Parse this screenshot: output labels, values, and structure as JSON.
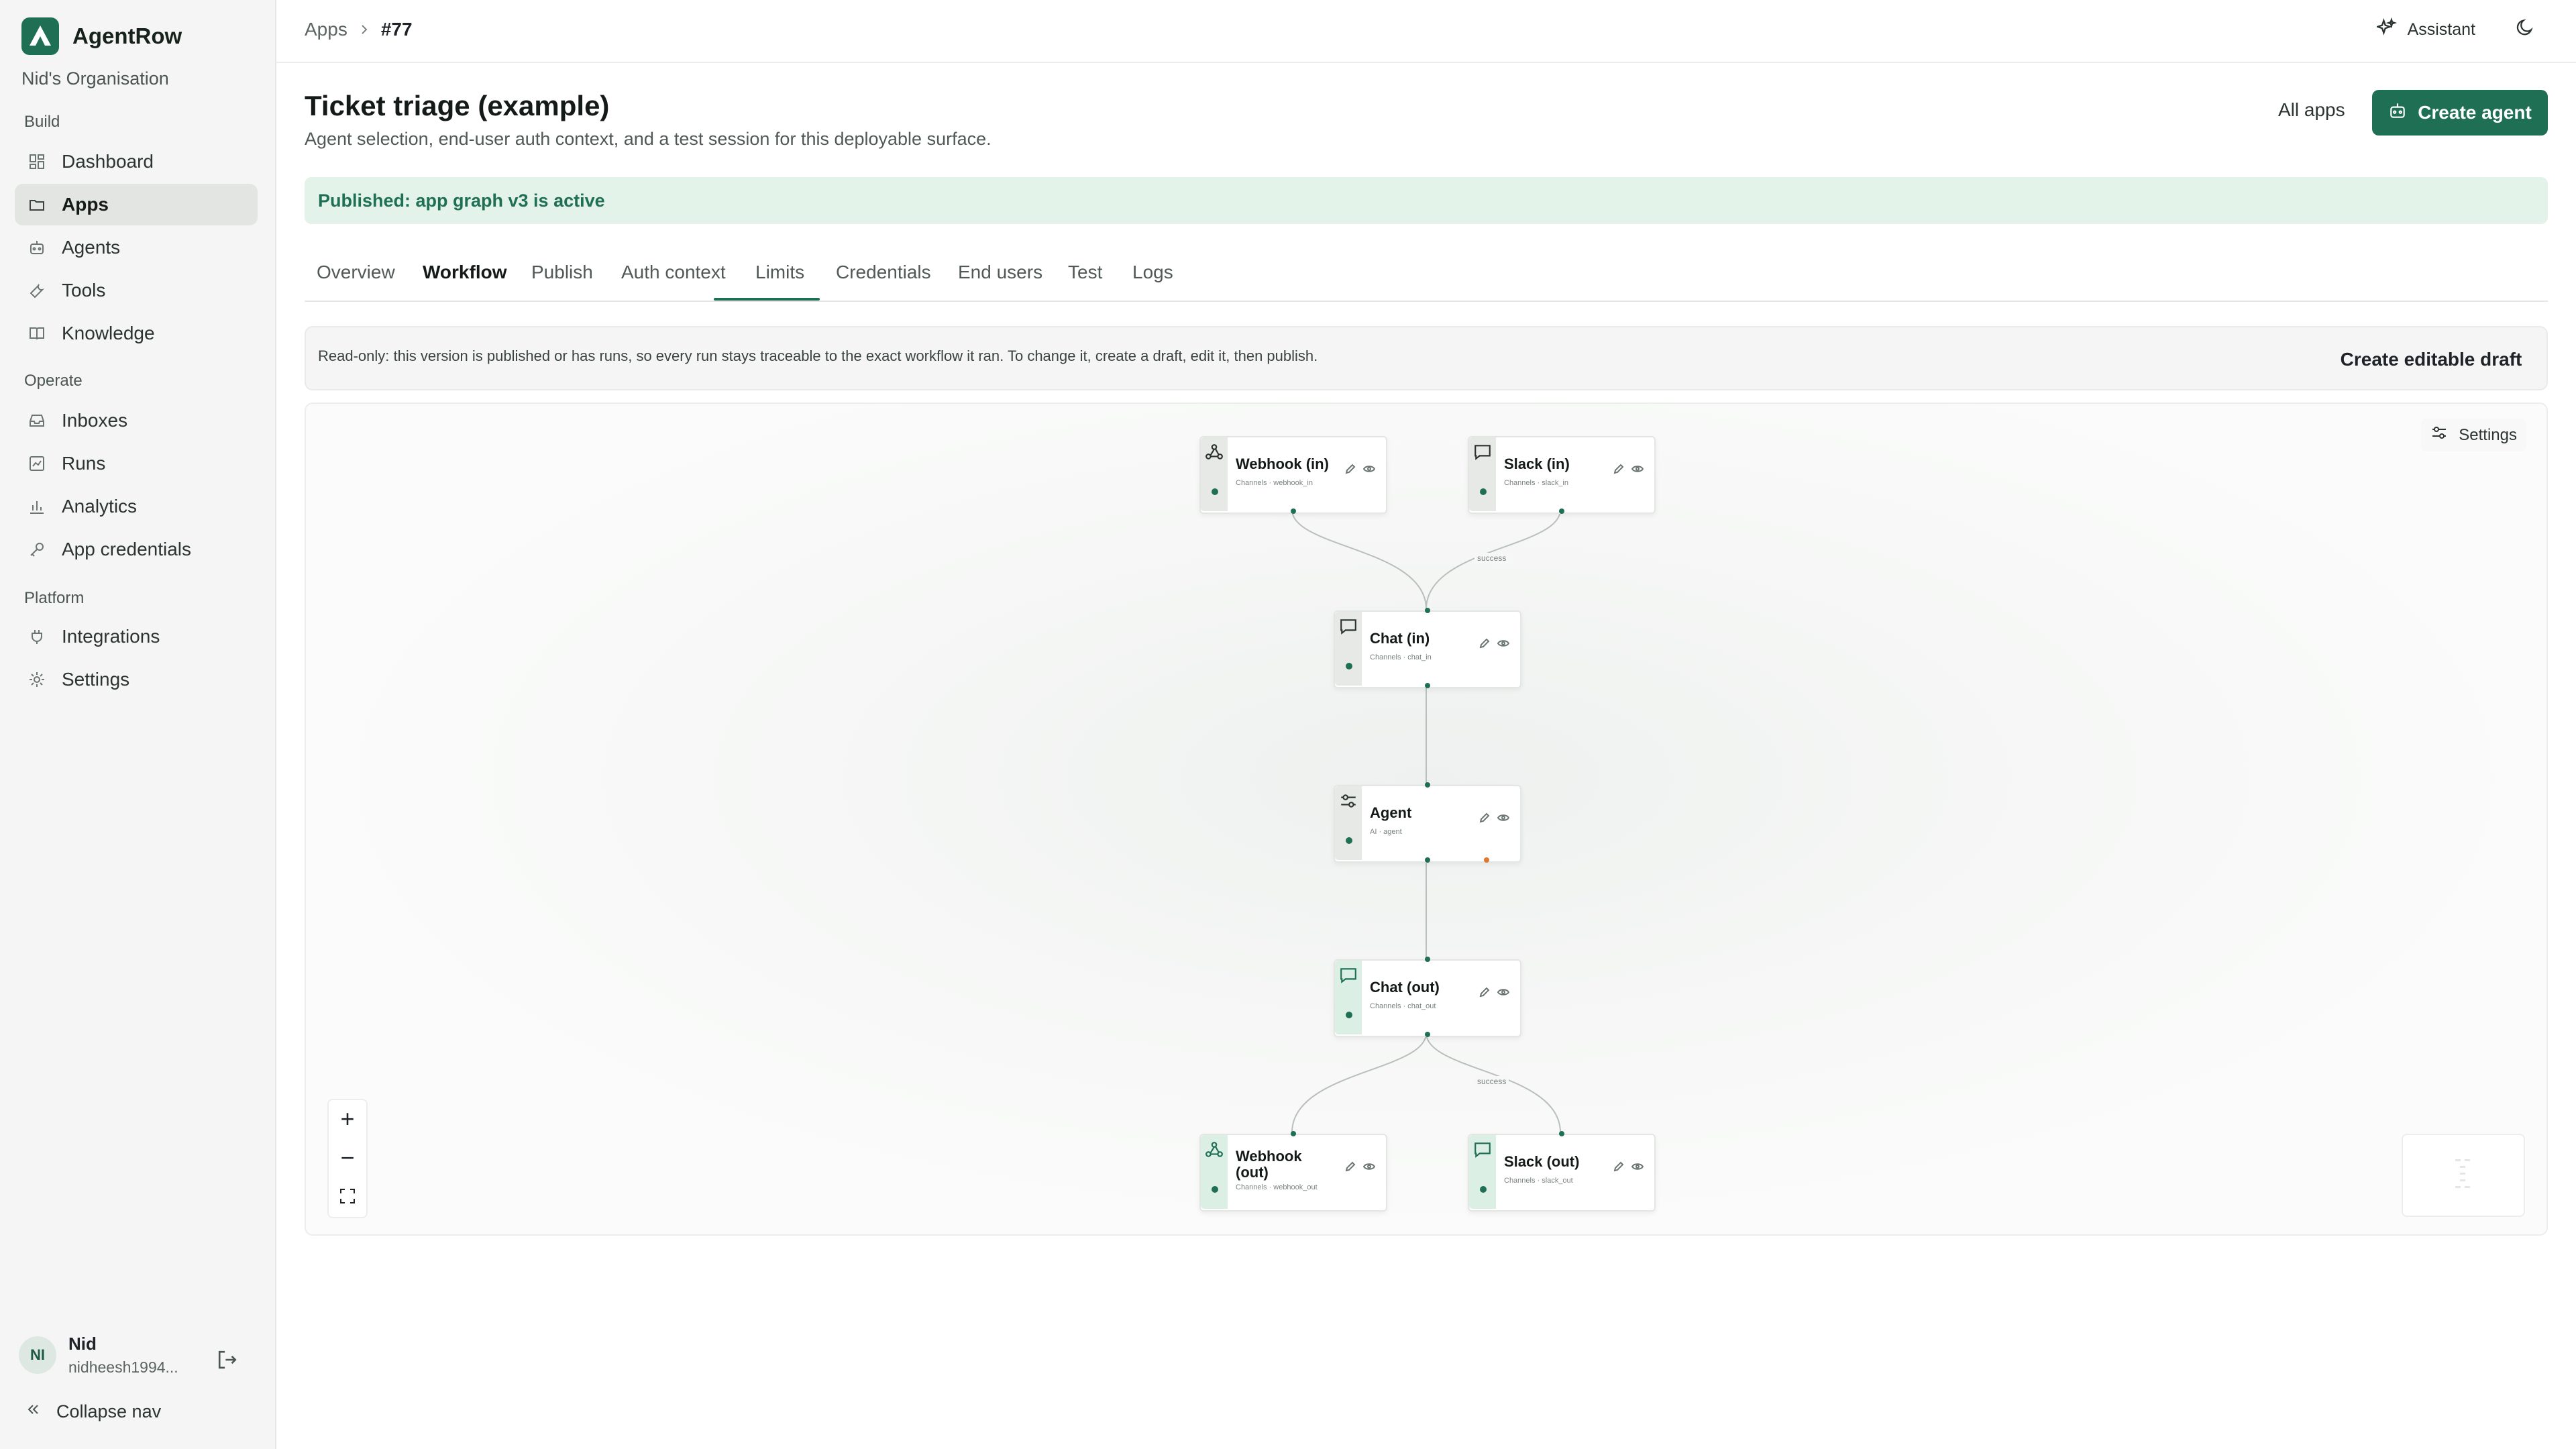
{
  "sidebar": {
    "brand": "AgentRow",
    "org": "Nid's Organisation",
    "sections": {
      "build": "Build",
      "operate": "Operate",
      "platform": "Platform"
    },
    "items": [
      {
        "label": "Dashboard",
        "icon": "dashboard-icon"
      },
      {
        "label": "Apps",
        "icon": "apps-icon",
        "active": true
      },
      {
        "label": "Agents",
        "icon": "robot-icon"
      },
      {
        "label": "Tools",
        "icon": "wrench-icon"
      },
      {
        "label": "Knowledge",
        "icon": "book-icon"
      },
      {
        "label": "Inboxes",
        "icon": "inbox-icon"
      },
      {
        "label": "Runs",
        "icon": "runs-icon"
      },
      {
        "label": "Analytics",
        "icon": "analytics-icon"
      },
      {
        "label": "App credentials",
        "icon": "key-icon"
      },
      {
        "label": "Integrations",
        "icon": "plug-icon"
      },
      {
        "label": "Settings",
        "icon": "gear-icon"
      }
    ],
    "user": {
      "initials": "NI",
      "name": "Nid",
      "email": "nidheesh1994..."
    },
    "collapse": "Collapse nav"
  },
  "topbar": {
    "breadcrumb": [
      "Apps",
      "#77"
    ],
    "assistant": "Assistant"
  },
  "page": {
    "title": "Ticket triage (example)",
    "subtitle": "Agent selection, end-user auth context, and a test session for this deployable surface.",
    "all_apps": "All apps",
    "create_agent": "Create agent",
    "banner": "Published: app graph v3 is active"
  },
  "tabs": [
    "Overview",
    "Workflow",
    "Publish",
    "Auth context",
    "Limits",
    "Credentials",
    "End users",
    "Test",
    "Logs"
  ],
  "active_tab": "Workflow",
  "readonly": {
    "text": "Read-only: this version is published or has runs, so every run stays traceable to the exact workflow it ran. To change it, create a draft, edit it, then publish.",
    "button": "Create editable draft"
  },
  "canvas": {
    "settings": "Settings",
    "edge_labels": [
      "success",
      "success"
    ],
    "nodes": [
      {
        "title": "Webhook (in)",
        "sub": "Channels · webhook_in",
        "icon": "webhook-icon"
      },
      {
        "title": "Slack (in)",
        "sub": "Channels · slack_in",
        "icon": "chat-icon"
      },
      {
        "title": "Chat (in)",
        "sub": "Channels · chat_in",
        "icon": "chat-icon"
      },
      {
        "title": "Agent",
        "sub": "AI · agent",
        "icon": "agent-icon"
      },
      {
        "title": "Chat (out)",
        "sub": "Channels · chat_out",
        "icon": "chat-icon"
      },
      {
        "title": "Webhook (out)",
        "sub": "Channels · webhook_out",
        "icon": "webhook-icon"
      },
      {
        "title": "Slack (out)",
        "sub": "Channels · slack_out",
        "icon": "chat-icon"
      }
    ],
    "zoom": {
      "in": "+",
      "out": "−"
    }
  }
}
